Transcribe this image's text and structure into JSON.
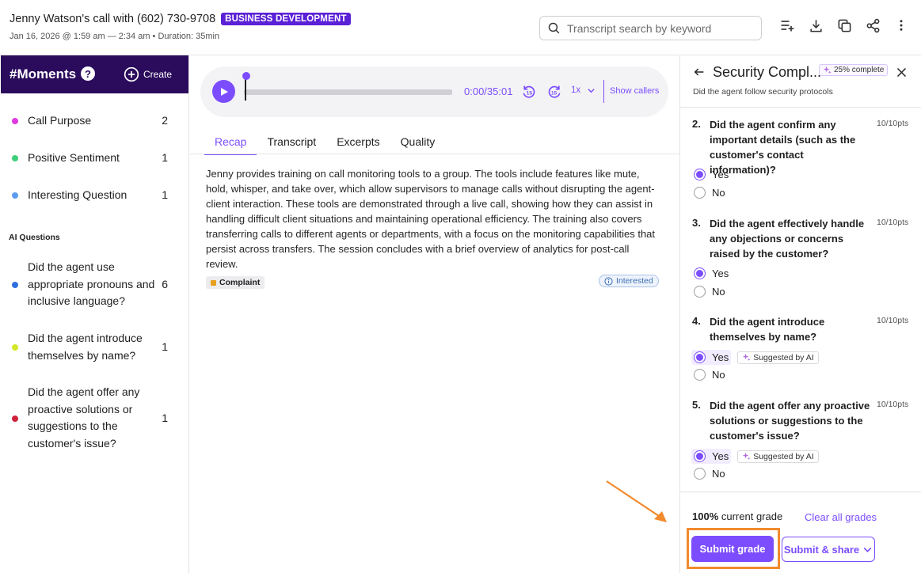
{
  "header": {
    "call_title": "Jenny Watson's call with (602) 730-9708",
    "department": "BUSINESS DEVELOPMENT",
    "meta": "Jan 16, 2026 @ 1:59 am — 2:34 am • Duration: 35min",
    "search_placeholder": "Transcript search by keyword",
    "icons": [
      "add-to-playlist-icon",
      "download-icon",
      "copy-icon",
      "share-icon",
      "more-vertical-icon"
    ]
  },
  "sidebar": {
    "title": "#Moments",
    "help": "?",
    "create_label": "Create",
    "moments": [
      {
        "label": "Call Purpose",
        "count": "2",
        "color": "#e03ae0"
      },
      {
        "label": "Positive Sentiment",
        "count": "1",
        "color": "#3ecf7a"
      },
      {
        "label": "Interesting Question",
        "count": "1",
        "color": "#5b9cf0"
      }
    ],
    "ai_questions_heading": "AI Questions",
    "ai_questions": [
      {
        "label": "Did the agent use appropriate pronouns and inclusive language?",
        "count": "6",
        "color": "#2f6fe0"
      },
      {
        "label": "Did the agent introduce themselves by name?",
        "count": "1",
        "color": "#d4e62a"
      },
      {
        "label": "Did the agent offer any proactive solutions or suggestions to the customer's issue?",
        "count": "1",
        "color": "#d0213b"
      }
    ]
  },
  "player": {
    "time": "0:00/35:01",
    "skip_back": "15",
    "skip_forward": "15",
    "speed": "1x",
    "show_callers": "Show callers",
    "progress": 0
  },
  "tabs": [
    "Recap",
    "Transcript",
    "Excerpts",
    "Quality"
  ],
  "active_tab": "Recap",
  "recap": {
    "text": "Jenny provides training on call monitoring tools to a group. The tools include features like mute, hold, whisper, and take over, which allow supervisors to manage calls without disrupting the agent-client interaction. These tools are demonstrated through a live call, showing how they can assist in handling difficult client situations and maintaining operational efficiency. The training also covers transferring calls to different agents or departments, with a focus on the monitoring capabilities that persist across transfers. The session concludes with a brief overview of analytics for post-call review.",
    "tag_left": "Complaint",
    "tag_right": "Interested"
  },
  "scorecard": {
    "title": "Security Compl...",
    "complete": "25% complete",
    "subtitle": "Did the agent follow security protocols",
    "questions": [
      {
        "num": "2.",
        "text": "Did the agent confirm any important details (such as the customer's contact information)?",
        "points": "10/10pts",
        "yes": "Yes",
        "no": "No",
        "selected": "Yes",
        "ai": ""
      },
      {
        "num": "3.",
        "text": "Did the agent effectively handle any objections or concerns raised by the customer?",
        "points": "10/10pts",
        "yes": "Yes",
        "no": "No",
        "selected": "Yes",
        "ai": ""
      },
      {
        "num": "4.",
        "text": "Did the agent introduce themselves by name?",
        "points": "10/10pts",
        "yes": "Yes",
        "no": "No",
        "selected": "Yes",
        "ai": "Suggested by AI"
      },
      {
        "num": "5.",
        "text": "Did the agent offer any proactive solutions or suggestions to the customer's issue?",
        "points": "10/10pts",
        "yes": "Yes",
        "no": "No",
        "selected": "Yes",
        "ai": "Suggested by AI"
      }
    ],
    "grade_value": "100%",
    "grade_label": "current grade",
    "clear_label": "Clear all grades",
    "submit_label": "Submit grade",
    "submit_share_label": "Submit & share"
  },
  "colors": {
    "accent": "#7c4dff",
    "moments_header": "#2b0b5c",
    "department_badge": "#5b21d6",
    "highlight_outline": "#f28a2e"
  }
}
